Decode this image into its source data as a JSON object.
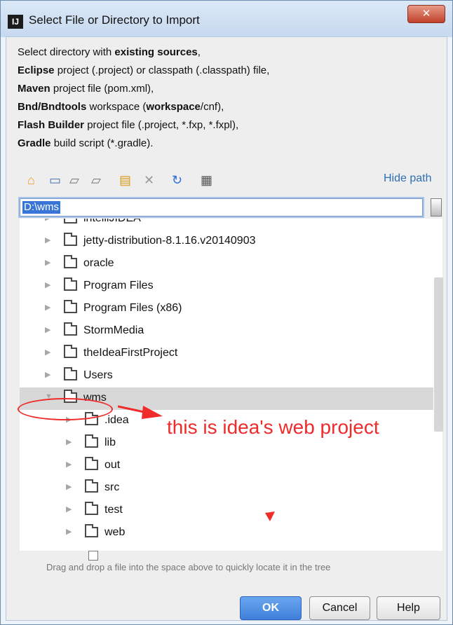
{
  "window": {
    "title": "Select File or Directory to Import",
    "app_icon": "IJ",
    "close": "✕"
  },
  "description": {
    "lines": [
      {
        "plain_before": "Select directory with ",
        "bold": "existing sources",
        "plain_after": ","
      },
      {
        "plain_before": "",
        "bold": "Eclipse",
        "plain_after": " project (.project) or classpath (.classpath) file,"
      },
      {
        "plain_before": "",
        "bold": "Maven",
        "plain_after": " project file (pom.xml),"
      },
      {
        "plain_before": "",
        "bold": "Bnd/Bndtools",
        "plain_after": " workspace (",
        "bold2": "workspace",
        "plain_after2": "/cnf),"
      },
      {
        "plain_before": "",
        "bold": "Flash Builder",
        "plain_after": " project file (.project, *.fxp, *.fxpl),"
      },
      {
        "plain_before": "",
        "bold": "Gradle",
        "plain_after": " build script (*.gradle)."
      }
    ]
  },
  "toolbar": {
    "hide_path": "Hide path"
  },
  "path_input": {
    "value": "D:\\wms"
  },
  "tree": {
    "items": [
      {
        "label": "intelliJIDEA",
        "depth": 0,
        "expanded": false
      },
      {
        "label": "jetty-distribution-8.1.16.v20140903",
        "depth": 0,
        "expanded": false
      },
      {
        "label": "oracle",
        "depth": 0,
        "expanded": false
      },
      {
        "label": "Program Files",
        "depth": 0,
        "expanded": false
      },
      {
        "label": "Program Files (x86)",
        "depth": 0,
        "expanded": false
      },
      {
        "label": "StormMedia",
        "depth": 0,
        "expanded": false
      },
      {
        "label": "theIdeaFirstProject",
        "depth": 0,
        "expanded": false
      },
      {
        "label": "Users",
        "depth": 0,
        "expanded": false
      },
      {
        "label": "wms",
        "depth": 0,
        "expanded": true,
        "selected": true
      },
      {
        "label": ".idea",
        "depth": 1,
        "expanded": false
      },
      {
        "label": "lib",
        "depth": 1,
        "expanded": false
      },
      {
        "label": "out",
        "depth": 1,
        "expanded": false
      },
      {
        "label": "src",
        "depth": 1,
        "expanded": false
      },
      {
        "label": "test",
        "depth": 1,
        "expanded": false
      },
      {
        "label": "web",
        "depth": 1,
        "expanded": false
      }
    ]
  },
  "annotation": "this is idea's web project",
  "hint": "Drag and drop a file into the space above to quickly locate it in the tree",
  "buttons": {
    "ok": "OK",
    "cancel": "Cancel",
    "help": "Help"
  },
  "colors": {
    "accent": "#3f7fda",
    "annotation": "#ef2b2b",
    "link": "#2d6fb2"
  }
}
